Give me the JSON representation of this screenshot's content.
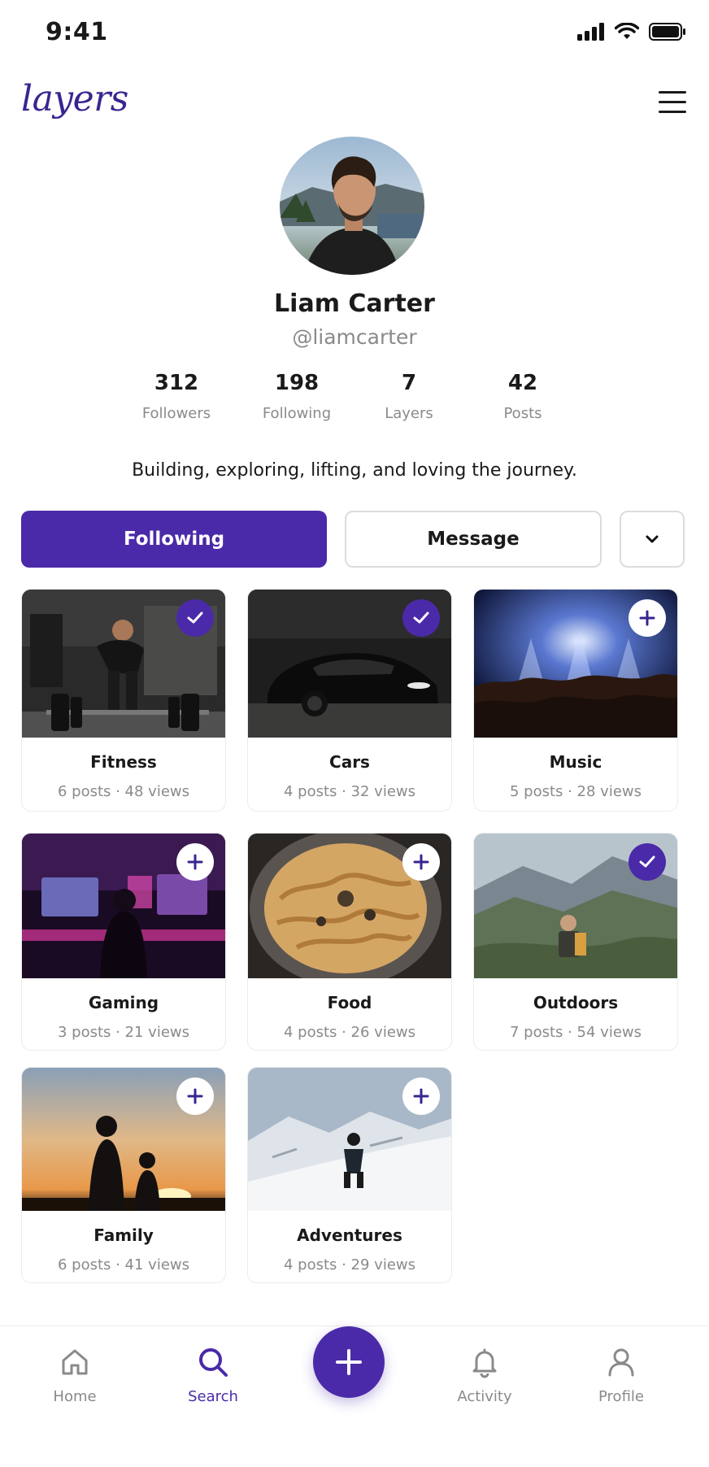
{
  "status_bar": {
    "time": "9:41"
  },
  "header": {
    "logo": "layers"
  },
  "profile": {
    "name": "Liam Carter",
    "handle": "@liamcarter",
    "bio": "Building, exploring, lifting, and loving the journey.",
    "stats": [
      {
        "value": "312",
        "label": "Followers"
      },
      {
        "value": "198",
        "label": "Following"
      },
      {
        "value": "7",
        "label": "Layers"
      },
      {
        "value": "42",
        "label": "Posts"
      }
    ]
  },
  "actions": {
    "follow_label": "Following",
    "message_label": "Message"
  },
  "layers": [
    {
      "title": "Fitness",
      "meta": "6 posts · 48 views",
      "followed": true
    },
    {
      "title": "Cars",
      "meta": "4 posts · 32 views",
      "followed": true
    },
    {
      "title": "Music",
      "meta": "5 posts · 28 views",
      "followed": false
    },
    {
      "title": "Gaming",
      "meta": "3 posts · 21 views",
      "followed": false
    },
    {
      "title": "Food",
      "meta": "4 posts · 26 views",
      "followed": false
    },
    {
      "title": "Outdoors",
      "meta": "7 posts · 54 views",
      "followed": true
    },
    {
      "title": "Family",
      "meta": "6 posts · 41 views",
      "followed": false
    },
    {
      "title": "Adventures",
      "meta": "4 posts · 29 views",
      "followed": false
    }
  ],
  "nav": {
    "items": [
      {
        "label": "Home",
        "icon": "home-icon"
      },
      {
        "label": "Search",
        "icon": "search-icon"
      },
      {
        "label": "Activity",
        "icon": "bell-icon"
      },
      {
        "label": "Profile",
        "icon": "user-icon"
      }
    ],
    "active": "Search"
  },
  "colors": {
    "accent": "#4a2aa8",
    "muted": "#8a8a8a"
  }
}
